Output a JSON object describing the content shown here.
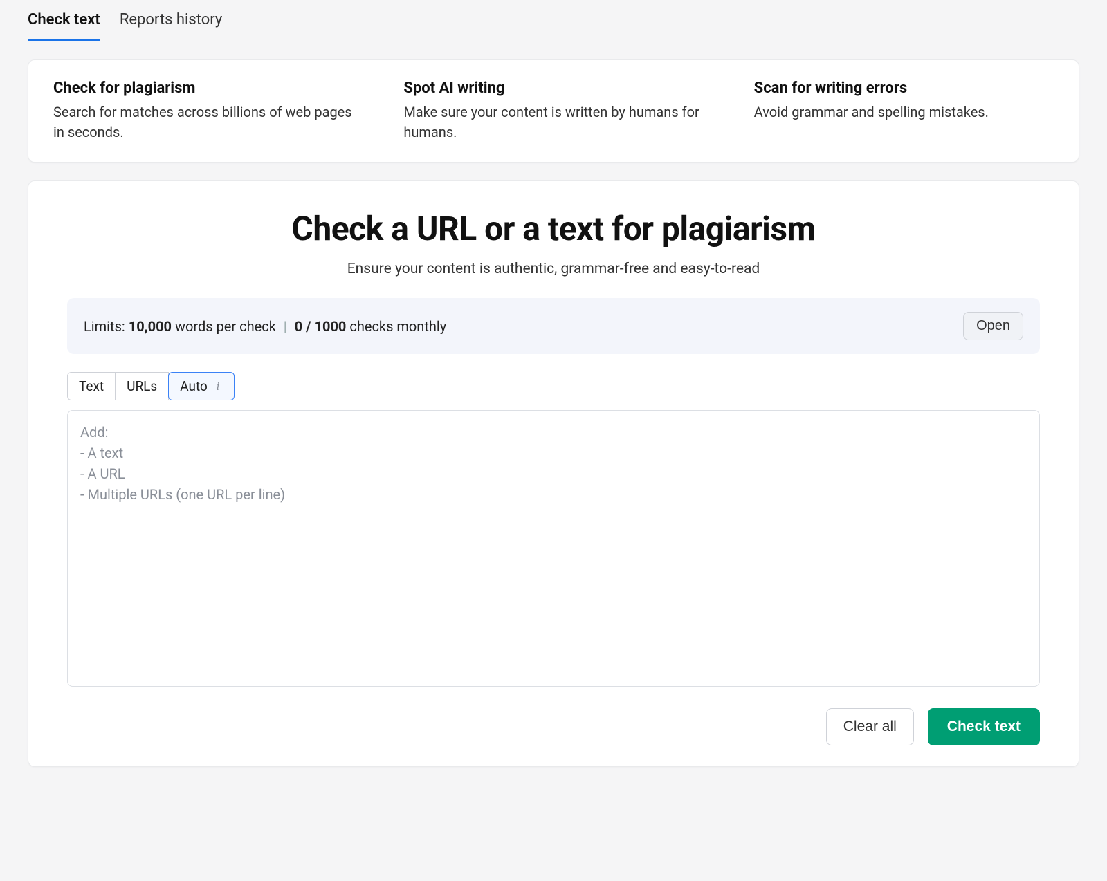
{
  "tabs": {
    "items": [
      {
        "label": "Check text",
        "active": true
      },
      {
        "label": "Reports history",
        "active": false
      }
    ]
  },
  "features": [
    {
      "title": "Check for plagiarism",
      "desc": "Search for matches across billions of web pages in seconds."
    },
    {
      "title": "Spot AI writing",
      "desc": "Make sure your content is written by humans for humans."
    },
    {
      "title": "Scan for writing errors",
      "desc": "Avoid grammar and spelling mistakes."
    }
  ],
  "main": {
    "title": "Check a URL or a text for plagiarism",
    "subtitle": "Ensure your content is authentic, grammar-free and easy-to-read"
  },
  "limits": {
    "prefix": "Limits: ",
    "words_count": "10,000",
    "words_suffix": " words per check",
    "divider": " | ",
    "checks_used": "0 / 1000",
    "checks_suffix": " checks monthly",
    "open_label": "Open"
  },
  "modes": {
    "items": [
      {
        "label": "Text",
        "selected": false
      },
      {
        "label": "URLs",
        "selected": false
      },
      {
        "label": "Auto",
        "selected": true,
        "info": true
      }
    ]
  },
  "textarea": {
    "value": "",
    "placeholder": "Add:\n - A text\n - A URL\n - Multiple URLs (one URL per line)"
  },
  "actions": {
    "clear_label": "Clear all",
    "check_label": "Check text"
  }
}
